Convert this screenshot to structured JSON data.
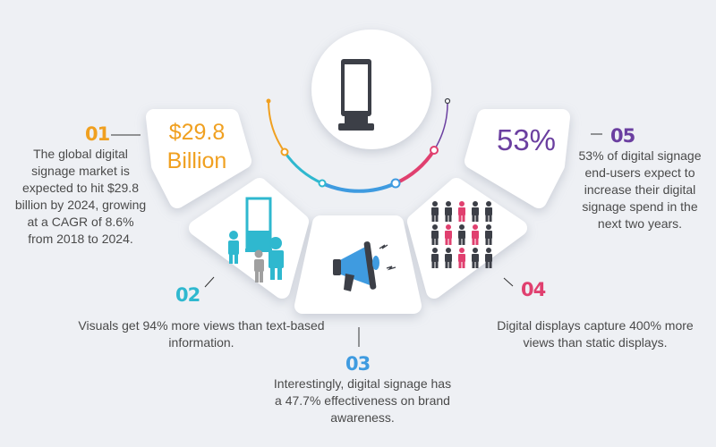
{
  "colors": {
    "orange": "#f0a020",
    "teal": "#2fb8cf",
    "blue": "#3f9be0",
    "pink": "#e0406f",
    "purple": "#6b3fa0",
    "dark": "#3c3f47",
    "bg": "#eef0f4"
  },
  "items": [
    {
      "number": "01",
      "highlight_line1": "$29.8",
      "highlight_line2": "Billion",
      "text": "The global digital signage market is expected to hit $29.8 billion by 2024, growing at a CAGR of 8.6% from 2018 to 2024.",
      "icon": "dollar-figure"
    },
    {
      "number": "02",
      "text": "Visuals get 94% more views than text-based information.",
      "icon": "people-at-kiosk-icon"
    },
    {
      "number": "03",
      "text": "Interestingly, digital signage has a 47.7% effectiveness on brand awareness.",
      "icon": "megaphone-icon"
    },
    {
      "number": "04",
      "text": "Digital displays capture 400% more views than static displays.",
      "icon": "people-grid-icon"
    },
    {
      "number": "05",
      "highlight": "53%",
      "text": "53% of digital signage end-users expect to increase their digital signage spend in the next two years.",
      "icon": "percent-figure"
    }
  ],
  "center_icon": "digital-kiosk-icon"
}
